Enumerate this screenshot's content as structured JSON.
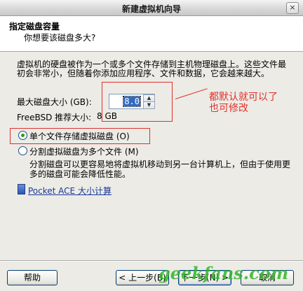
{
  "window": {
    "title": "新建虚拟机向导",
    "close_glyph": "×"
  },
  "header": {
    "title": "指定磁盘容量",
    "subtitle": "你想要该磁盘多大?"
  },
  "description": "虚拟机的硬盘被作为一个或多个文件存储到主机物理磁盘上。这些文件最初会非常小，但随着你添加应用程序、文件和数据，它会越来越大。",
  "max_size": {
    "label": "最大磁盘大小 (GB):",
    "value": "8.0"
  },
  "recommended": {
    "label": "FreeBSD 推荐大小:",
    "value": "8 GB"
  },
  "annotation": {
    "text": "都默认就可以了\n也可修改",
    "color": "#e0302a"
  },
  "options": [
    {
      "label": "单个文件存储虚拟磁盘 (O)",
      "selected": true
    },
    {
      "label": "分割虚拟磁盘为多个文件 (M)",
      "selected": false
    }
  ],
  "split_description": "分割磁盘可以更容易地将虚拟机移动到另一台计算机上，但由于使用更多的磁盘可能会降低性能。",
  "calc_link": "Pocket ACE 大小计算",
  "buttons": {
    "help": "帮助",
    "back": "< 上一步(B)",
    "next": "下一步(N) >",
    "cancel": "取消"
  },
  "watermark": "geekfans.com"
}
